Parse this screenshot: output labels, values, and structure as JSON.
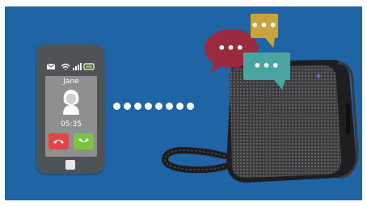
{
  "phone": {
    "caller_name": "Jane",
    "call_time": "05:35",
    "icons": [
      "mail-icon",
      "wifi-icon",
      "signal-icon",
      "battery-icon",
      "person-icon",
      "decline-call-icon",
      "answer-call-icon"
    ]
  },
  "bubbles": {
    "red": {
      "text": "•••",
      "color": "#9b2a3f"
    },
    "gold": {
      "text": "•••",
      "color": "#c8a23a"
    },
    "teal": {
      "text": "•••",
      "color": "#4aa5a2"
    }
  },
  "colors": {
    "background": "#1f65a6",
    "phone_body": "#4f5256",
    "speaker_body": "#2b2b2d",
    "decline": "#e04545",
    "answer": "#7cc340"
  }
}
